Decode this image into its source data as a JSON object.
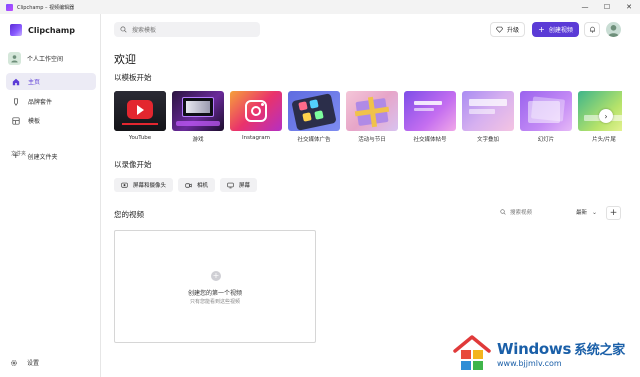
{
  "window": {
    "title": "Clipchamp – 视频编辑器",
    "minimize": "—",
    "maximize": "☐",
    "close": "✕"
  },
  "sidebar": {
    "brand": "Clipchamp",
    "workspace": "个人工作空间",
    "items": [
      {
        "label": "主页",
        "icon": "home-icon",
        "active": true
      },
      {
        "label": "品牌套件",
        "icon": "brand-kit-icon",
        "active": false
      },
      {
        "label": "模板",
        "icon": "template-icon",
        "active": false
      }
    ],
    "folders_label": "文件夹",
    "create_folder": "创建文件夹",
    "settings": "设置"
  },
  "header": {
    "search_placeholder": "搜索模板",
    "upgrade_label": "升级",
    "create_label": "创建视频"
  },
  "main": {
    "welcome": "欢迎",
    "templates_heading": "以模板开始",
    "templates": [
      {
        "label": "YouTube"
      },
      {
        "label": "游戏"
      },
      {
        "label": "Instagram"
      },
      {
        "label": "社交媒体广告"
      },
      {
        "label": "活动与节日"
      },
      {
        "label": "社交媒体帖号"
      },
      {
        "label": "文字叠加"
      },
      {
        "label": "幻灯片"
      },
      {
        "label": "片头/片尾"
      }
    ],
    "record_heading": "以录像开始",
    "record_buttons": [
      {
        "label": "屏幕和摄像头",
        "icon": "screen-camera-icon"
      },
      {
        "label": "相机",
        "icon": "camera-icon"
      },
      {
        "label": "屏幕",
        "icon": "screen-icon"
      }
    ],
    "videos_heading": "您的视频",
    "video_search_placeholder": "搜索视频",
    "sort_label": "最新",
    "empty_title": "创建您的第一个视频",
    "empty_subtitle": "只有您能看到这些视频"
  },
  "watermark": {
    "brand": "Windows",
    "brand_cn": "系统之家",
    "url": "www.bjjmlv.com"
  },
  "colors": {
    "accent": "#5b3bd6",
    "active_nav_bg": "#ecebf5",
    "youtube_red": "#e3262f"
  }
}
